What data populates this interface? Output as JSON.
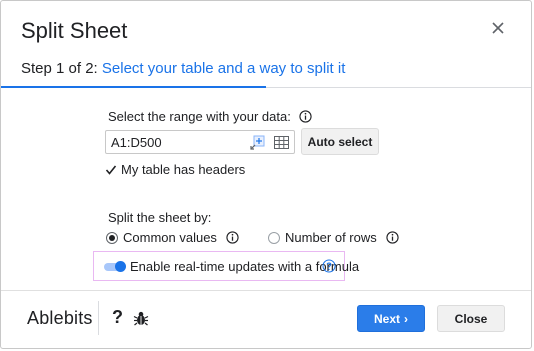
{
  "dialog": {
    "title": "Split Sheet",
    "close_icon": "close-icon"
  },
  "step": {
    "number": "Step 1 of 2:",
    "description": "Select your table and a way to split it",
    "accent_color": "#1a73e8"
  },
  "range": {
    "label": "Select the range with your data:",
    "value": "A1:D500",
    "select_icon": "select-range-icon",
    "grid_icon": "grid-icon",
    "auto_select_label": "Auto select"
  },
  "headers": {
    "label": "My table has headers",
    "checked": true
  },
  "split": {
    "label": "Split the sheet by:",
    "options": [
      {
        "label": "Common values",
        "selected": true
      },
      {
        "label": "Number of rows",
        "selected": false
      }
    ]
  },
  "realtime": {
    "label": "Enable real-time updates with a formula",
    "enabled": true,
    "help_icon": "help-circle-icon",
    "highlight_color": "#e9b8f2"
  },
  "footer": {
    "brand": "Ablebits",
    "help_label": "?",
    "bug_icon": "bug-icon",
    "next_label": "Next",
    "next_arrow": "›",
    "close_label": "Close",
    "next_color": "#2b7de9"
  }
}
